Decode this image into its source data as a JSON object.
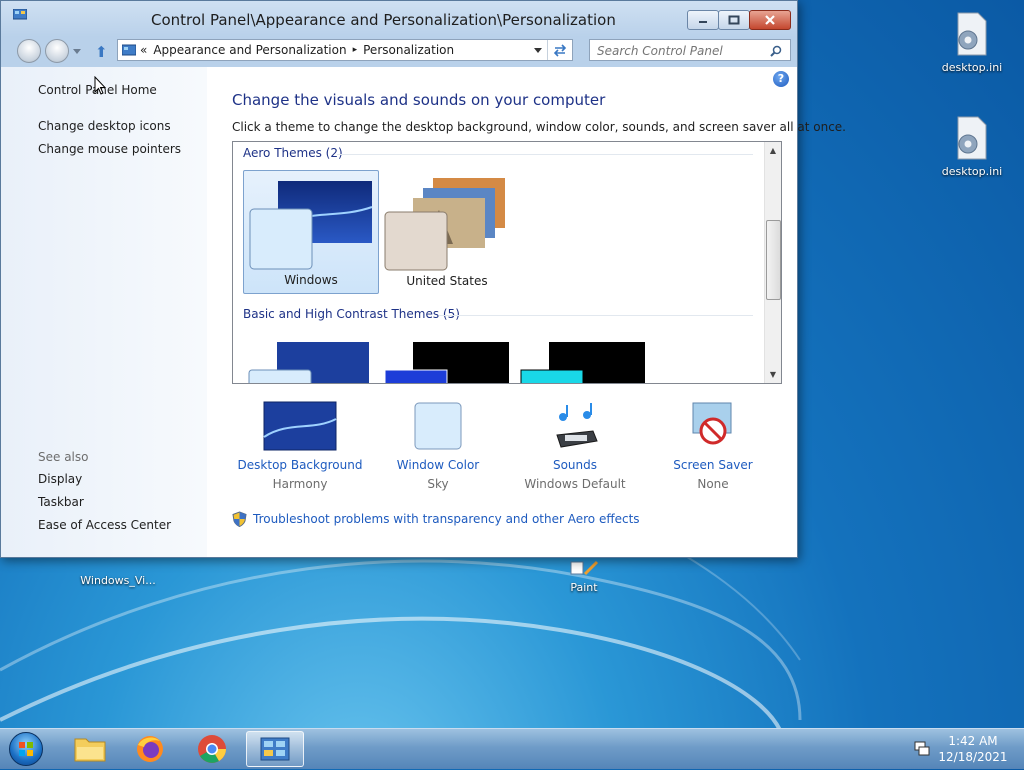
{
  "window": {
    "title": "Control Panel\\Appearance and Personalization\\Personalization",
    "address": {
      "prefix": "«",
      "segments": [
        "Appearance and Personalization",
        "Personalization"
      ],
      "separator": "▸"
    },
    "search_placeholder": "Search Control Panel"
  },
  "sidebar": {
    "home": "Control Panel Home",
    "links": [
      "Change desktop icons",
      "Change mouse pointers"
    ],
    "see_also_label": "See also",
    "see_also": [
      "Display",
      "Taskbar",
      "Ease of Access Center"
    ]
  },
  "main": {
    "heading": "Change the visuals and sounds on your computer",
    "subheading": "Click a theme to change the desktop background, window color, sounds, and screen saver all at once.",
    "groups": [
      {
        "title": "Aero Themes (2)",
        "themes": [
          {
            "name": "Windows",
            "selected": true
          },
          {
            "name": "United States",
            "selected": false
          }
        ]
      },
      {
        "title": "Basic and High Contrast Themes (5)"
      }
    ],
    "settings": [
      {
        "label": "Desktop Background",
        "value": "Harmony"
      },
      {
        "label": "Window Color",
        "value": "Sky"
      },
      {
        "label": "Sounds",
        "value": "Windows Default"
      },
      {
        "label": "Screen Saver",
        "value": "None"
      }
    ],
    "troubleshoot": "Troubleshoot problems with transparency and other Aero effects"
  },
  "desktop": {
    "icons": [
      "desktop.ini",
      "desktop.ini",
      "Windows_Vi...",
      "Paint"
    ]
  },
  "taskbar": {
    "time": "1:42 AM",
    "date": "12/18/2021",
    "pinned": [
      "explorer-icon",
      "firefox-icon",
      "chrome-icon",
      "control-panel-icon"
    ]
  }
}
